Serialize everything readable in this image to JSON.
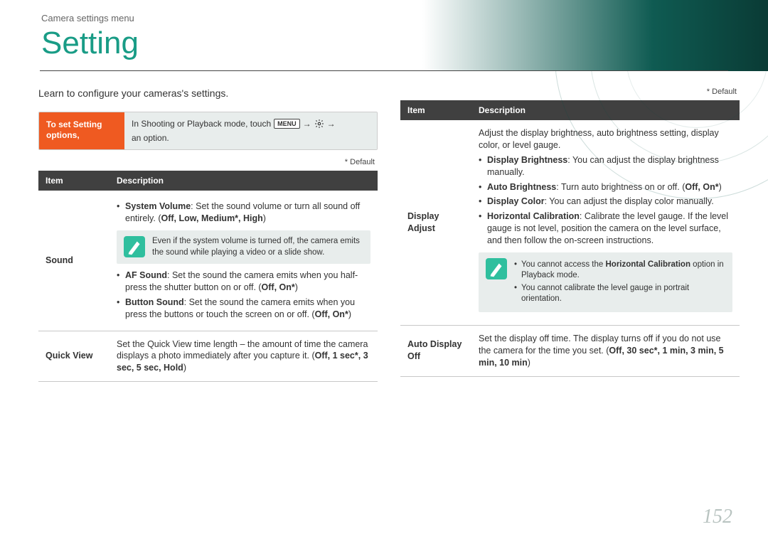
{
  "breadcrumb": "Camera settings menu",
  "page_title": "Setting",
  "intro": "Learn to configure your cameras's settings.",
  "instruct": {
    "label": "To set Setting options,",
    "prefix": "In Shooting or Playback mode, touch",
    "menu_key": "MENU",
    "arrow": "→",
    "suffix": "an option."
  },
  "default_note": "* Default",
  "table_headers": {
    "item": "Item",
    "desc": "Description"
  },
  "left": {
    "sound": {
      "item": "Sound",
      "sys_vol_label": "System Volume",
      "sys_vol_text": ": Set the sound volume or turn all sound off entirely. (",
      "sys_vol_opts": "Off, Low, Medium*, High",
      "sys_vol_close": ")",
      "note": "Even if the system volume is turned off, the camera emits the sound while playing a video or a slide show.",
      "af_label": "AF Sound",
      "af_text": ": Set the sound the camera emits when you half-press the shutter button on or off. (",
      "af_opts": "Off, On*",
      "af_close": ")",
      "btn_label": "Button Sound",
      "btn_text": ": Set the sound the camera emits when you press the buttons or touch the screen on or off. (",
      "btn_opts": "Off, On*",
      "btn_close": ")"
    },
    "quick": {
      "item": "Quick View",
      "text": "Set the Quick View time length – the amount of time the camera displays a photo immediately after you capture it. (",
      "opts": "Off, 1 sec*, 3 sec, 5 sec, Hold",
      "close": ")"
    }
  },
  "right": {
    "display": {
      "item": "Display Adjust",
      "lead": "Adjust the display brightness, auto brightness setting, display color, or level gauge.",
      "db_label": "Display Brightness",
      "db_text": ": You can adjust the display brightness manually.",
      "ab_label": "Auto Brightness",
      "ab_text": ": Turn auto brightness on or off. (",
      "ab_opts": "Off, On*",
      "ab_close": ")",
      "dc_label": "Display Color",
      "dc_text": ": You can adjust the display color manually.",
      "hc_label": "Horizontal Calibration",
      "hc_text": ": Calibrate the level gauge. If the level gauge is not level, position the camera on the level surface, and then follow the on-screen instructions.",
      "note1a": "You cannot access the ",
      "note1b": "Horizontal Calibration",
      "note1c": " option in Playback mode.",
      "note2": "You cannot calibrate the level gauge in portrait orientation."
    },
    "auto_off": {
      "item": "Auto Display Off",
      "text": "Set the display off time. The display turns off if you do not use the camera for the time you set. (",
      "opts": "Off, 30 sec*, 1 min, 3 min, 5 min, 10 min",
      "close": ")"
    }
  },
  "page_number": "152"
}
